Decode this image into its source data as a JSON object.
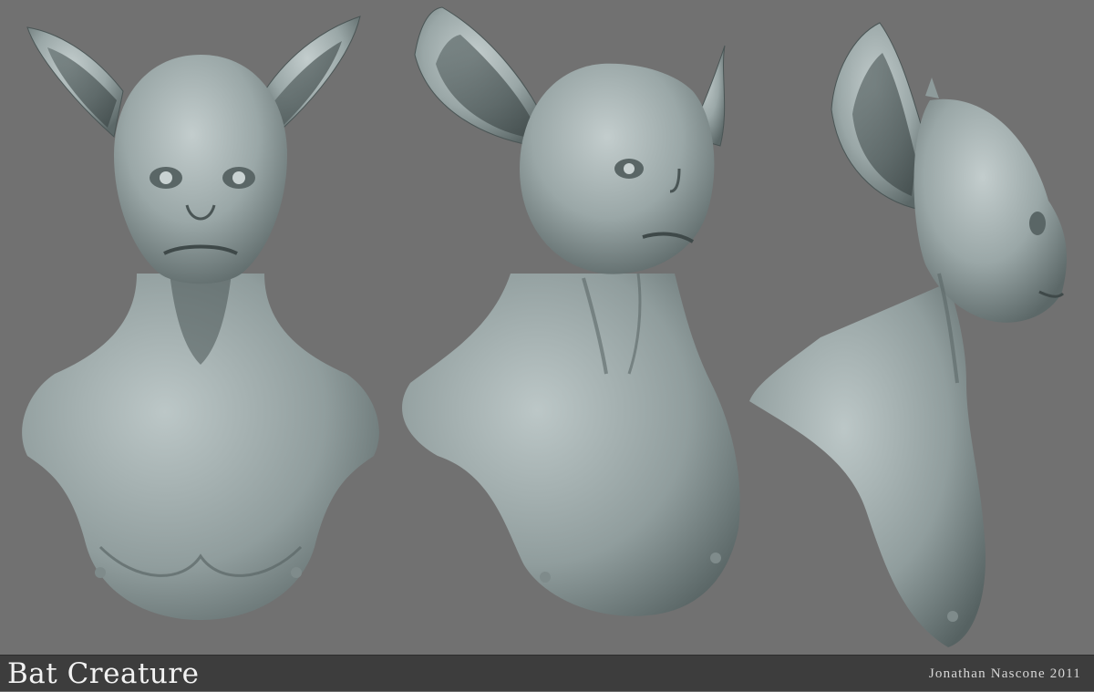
{
  "caption": {
    "title": "Bat Creature",
    "credit": "Jonathan Nascone 2011"
  },
  "colors": {
    "background": "#717171",
    "clay": "#9aa7a7",
    "clay_shadow": "#4d5858",
    "footer": "#3d3d3d"
  },
  "views": [
    "front",
    "three-quarter",
    "side"
  ]
}
